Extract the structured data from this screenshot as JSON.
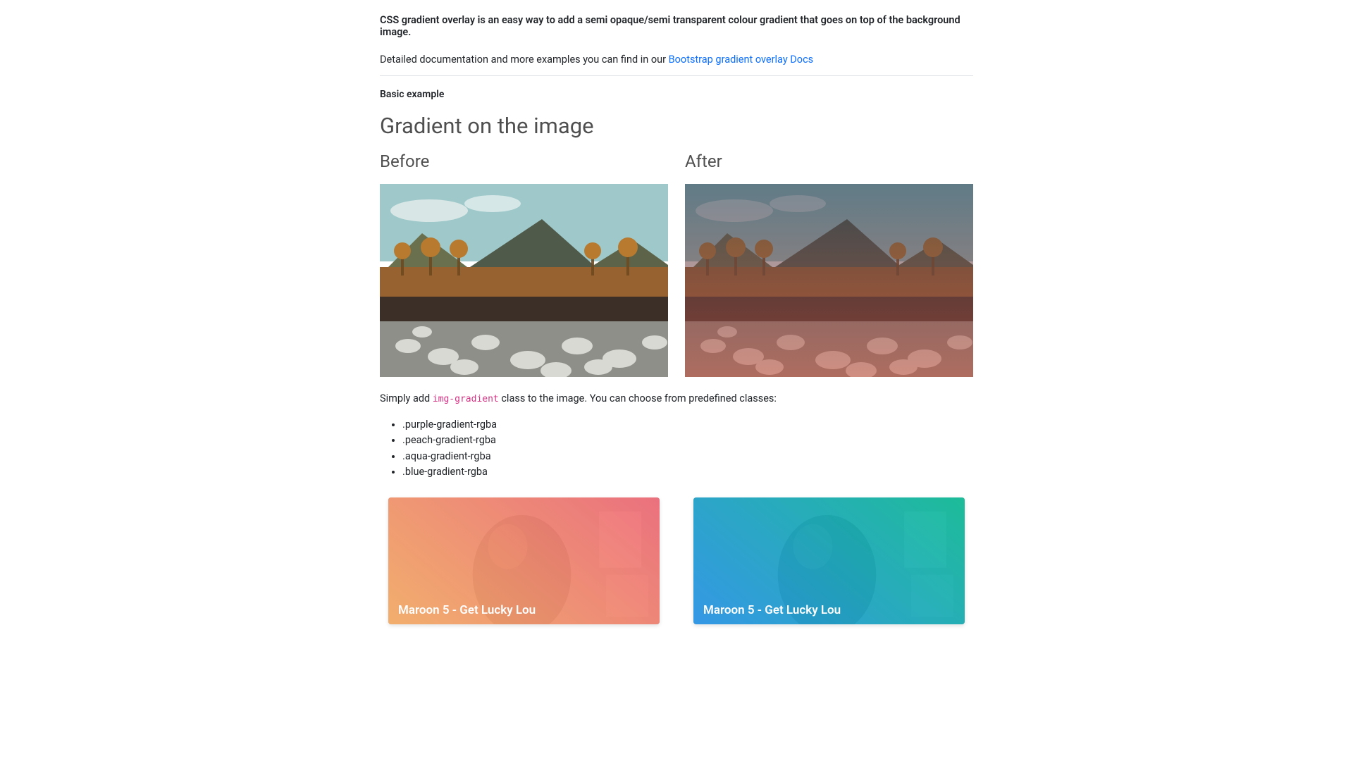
{
  "intro": {
    "lead": "CSS gradient overlay is an easy way to add a semi opaque/semi transparent colour gradient that goes on top of the background image.",
    "docs_prefix": "Detailed documentation and more examples you can find in our ",
    "docs_link_text": "Bootstrap gradient overlay Docs"
  },
  "section_label": "Basic example",
  "heading": "Gradient on the image",
  "before_label": "Before",
  "after_label": "After",
  "instruction": {
    "pre": "Simply add ",
    "code": "img-gradient",
    "post": " class to the image. You can choose from predefined classes:"
  },
  "class_list": [
    ".purple-gradient-rgba",
    ".peach-gradient-rgba",
    ".aqua-gradient-rgba",
    ".blue-gradient-rgba"
  ],
  "cards": [
    {
      "title": "Maroon 5 - Get Lucky Lou"
    },
    {
      "title": "Maroon 5 - Get Lucky Lou"
    }
  ]
}
